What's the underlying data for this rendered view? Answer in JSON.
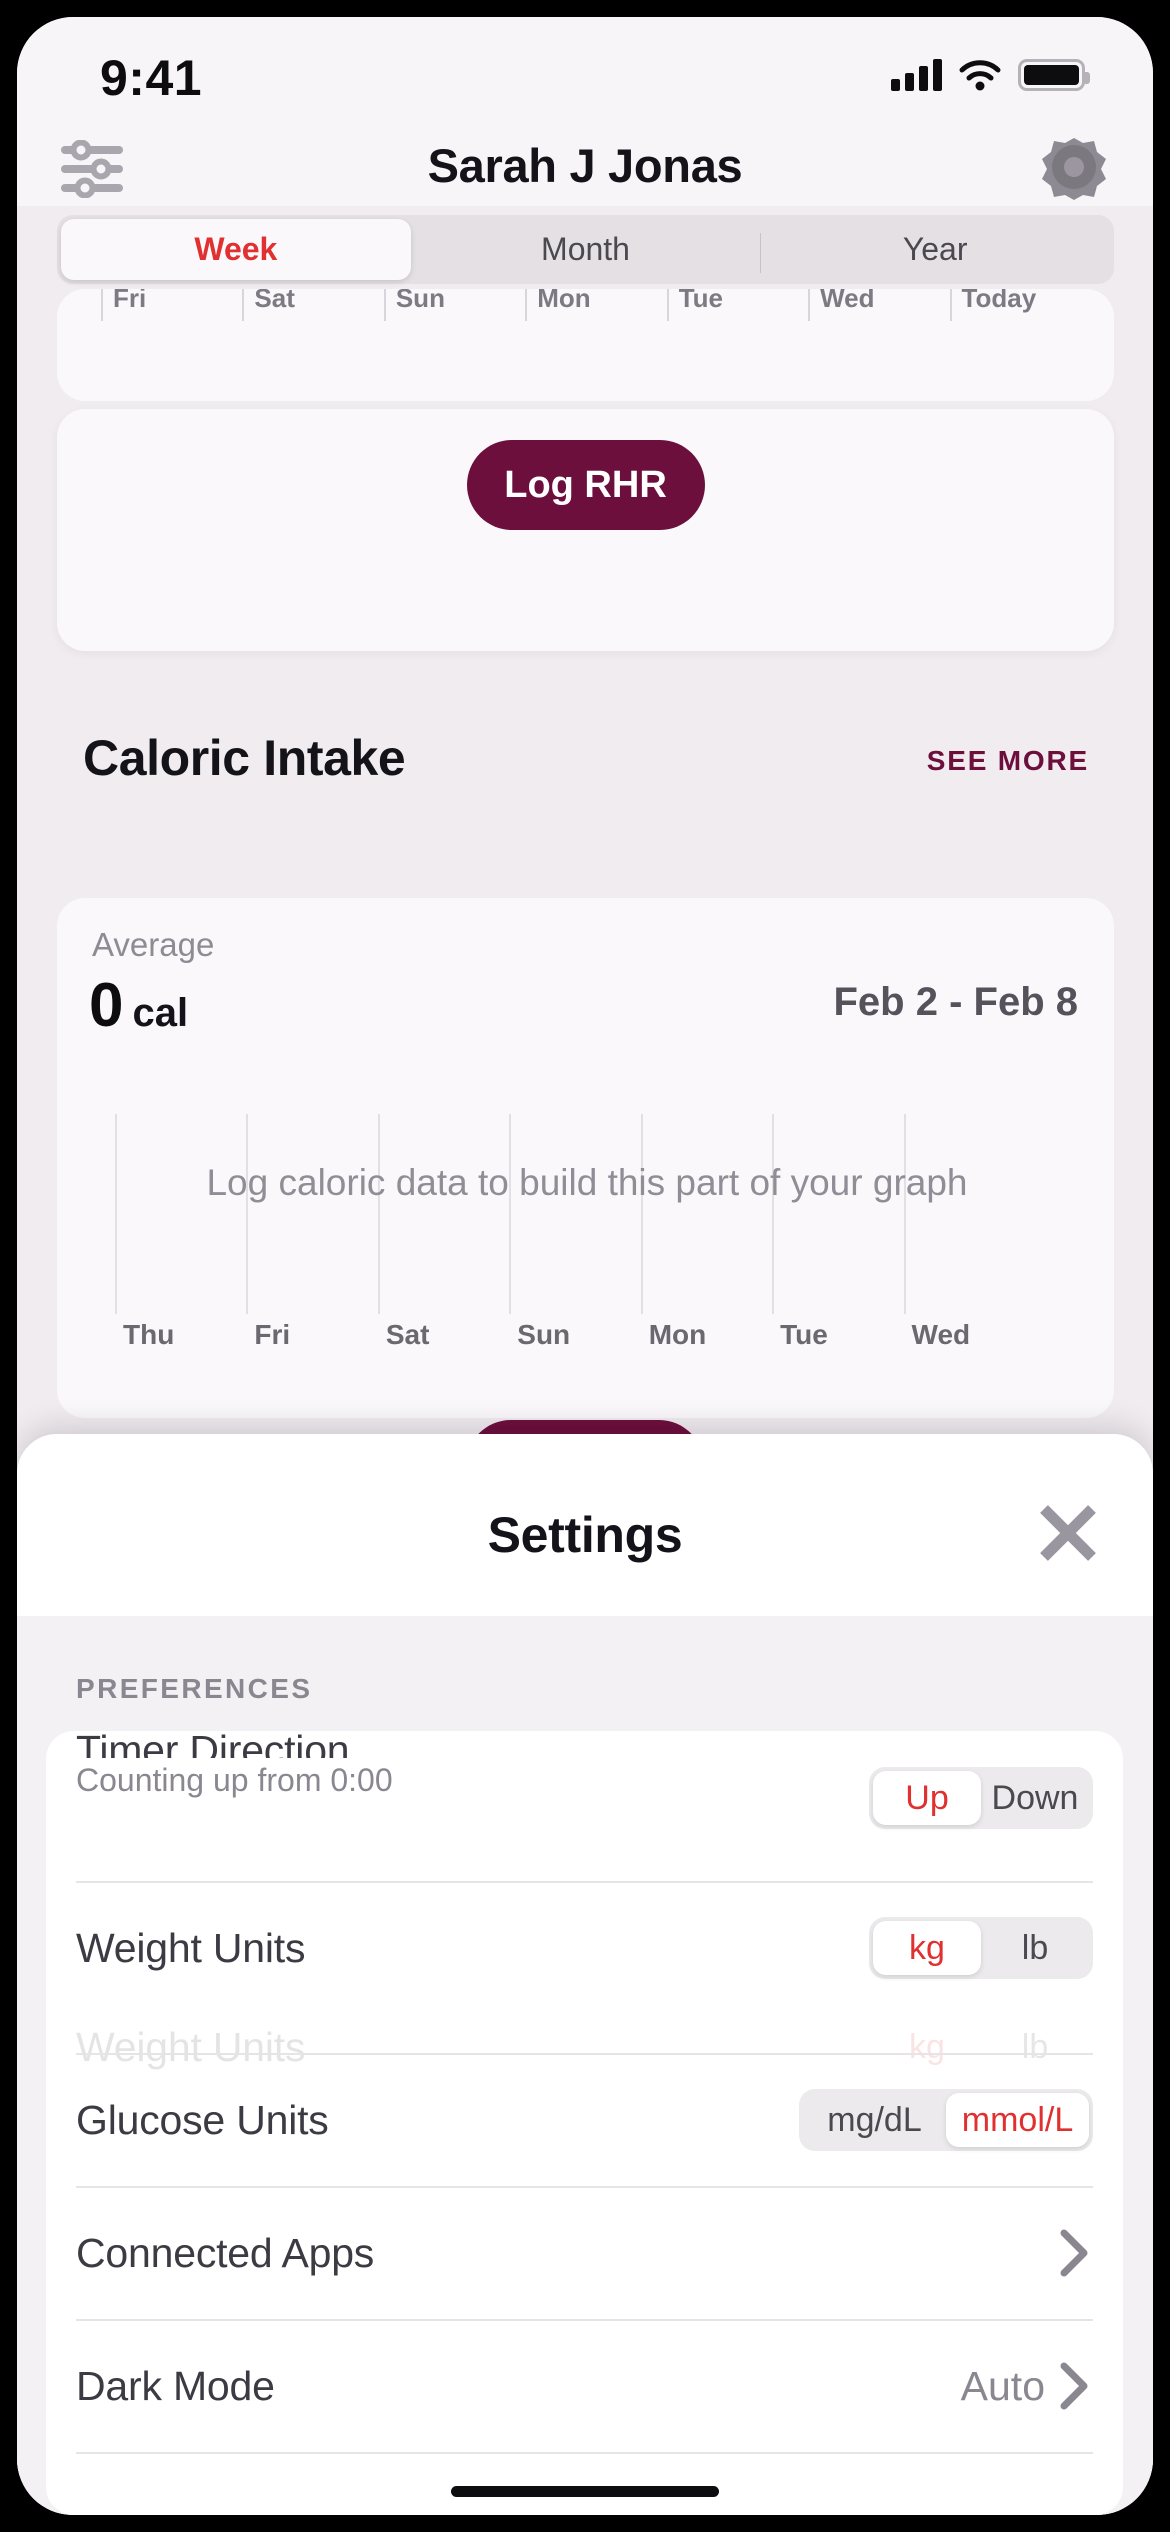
{
  "status_bar": {
    "time": "9:41",
    "cellular_icon": "cellular-signal-icon",
    "wifi_icon": "wifi-icon",
    "battery_icon": "battery-full-icon"
  },
  "header": {
    "title": "Sarah J Jonas",
    "left_icon": "sliders-filter-icon",
    "right_icon": "gear-icon"
  },
  "period_control": {
    "options": [
      "Week",
      "Month",
      "Year"
    ],
    "selected": "Week",
    "accent_color": "#e03030"
  },
  "rhr_card": {
    "day_labels": [
      "Fri",
      "Sat",
      "Sun",
      "Mon",
      "Tue",
      "Wed",
      "Today"
    ],
    "log_button_label": "Log RHR",
    "button_color": "#6d0f3d"
  },
  "caloric_section": {
    "title": "Caloric Intake",
    "see_more_label": "SEE MORE",
    "see_more_color": "#6d0f3d",
    "average_label": "Average",
    "average_value": "0",
    "average_unit": "cal",
    "date_range": "Feb 2 - Feb 8",
    "empty_message": "Log caloric data to build this part of your graph",
    "day_labels": [
      "Thu",
      "Fri",
      "Sat",
      "Sun",
      "Mon",
      "Tue",
      "Wed"
    ]
  },
  "chart_data": {
    "type": "bar",
    "title": "Caloric Intake",
    "categories": [
      "Thu",
      "Fri",
      "Sat",
      "Sun",
      "Mon",
      "Tue",
      "Wed"
    ],
    "values": [
      0,
      0,
      0,
      0,
      0,
      0,
      0
    ],
    "xlabel": "",
    "ylabel": "cal",
    "ylim": [
      0,
      0
    ],
    "grid": true,
    "legend": "none",
    "annotation": "Log caloric data to build this part of your graph",
    "summary_stat_label": "Average",
    "summary_stat_value": 0,
    "summary_stat_unit": "cal",
    "period": "Feb 2 - Feb 8"
  },
  "settings_sheet": {
    "title": "Settings",
    "close_icon": "close-x-icon",
    "section_label": "PREFERENCES",
    "rows": [
      {
        "name": "timer-direction",
        "title": "Timer Direction",
        "subtitle": "Counting up from 0:00",
        "control": "segmented",
        "options": [
          "Up",
          "Down"
        ],
        "selected": "Up"
      },
      {
        "name": "weight-units",
        "title": "Weight Units",
        "subtitle": "",
        "control": "segmented",
        "options": [
          "kg",
          "lb"
        ],
        "selected": "kg"
      },
      {
        "name": "glucose-units",
        "title": "Glucose Units",
        "subtitle": "",
        "control": "segmented",
        "options": [
          "mg/dL",
          "mmol/L"
        ],
        "selected": "mmol/L"
      },
      {
        "name": "connected-apps",
        "title": "Connected Apps",
        "subtitle": "",
        "control": "chevron",
        "value": ""
      },
      {
        "name": "dark-mode",
        "title": "Dark Mode",
        "subtitle": "",
        "control": "chevron",
        "value": "Auto"
      }
    ]
  }
}
